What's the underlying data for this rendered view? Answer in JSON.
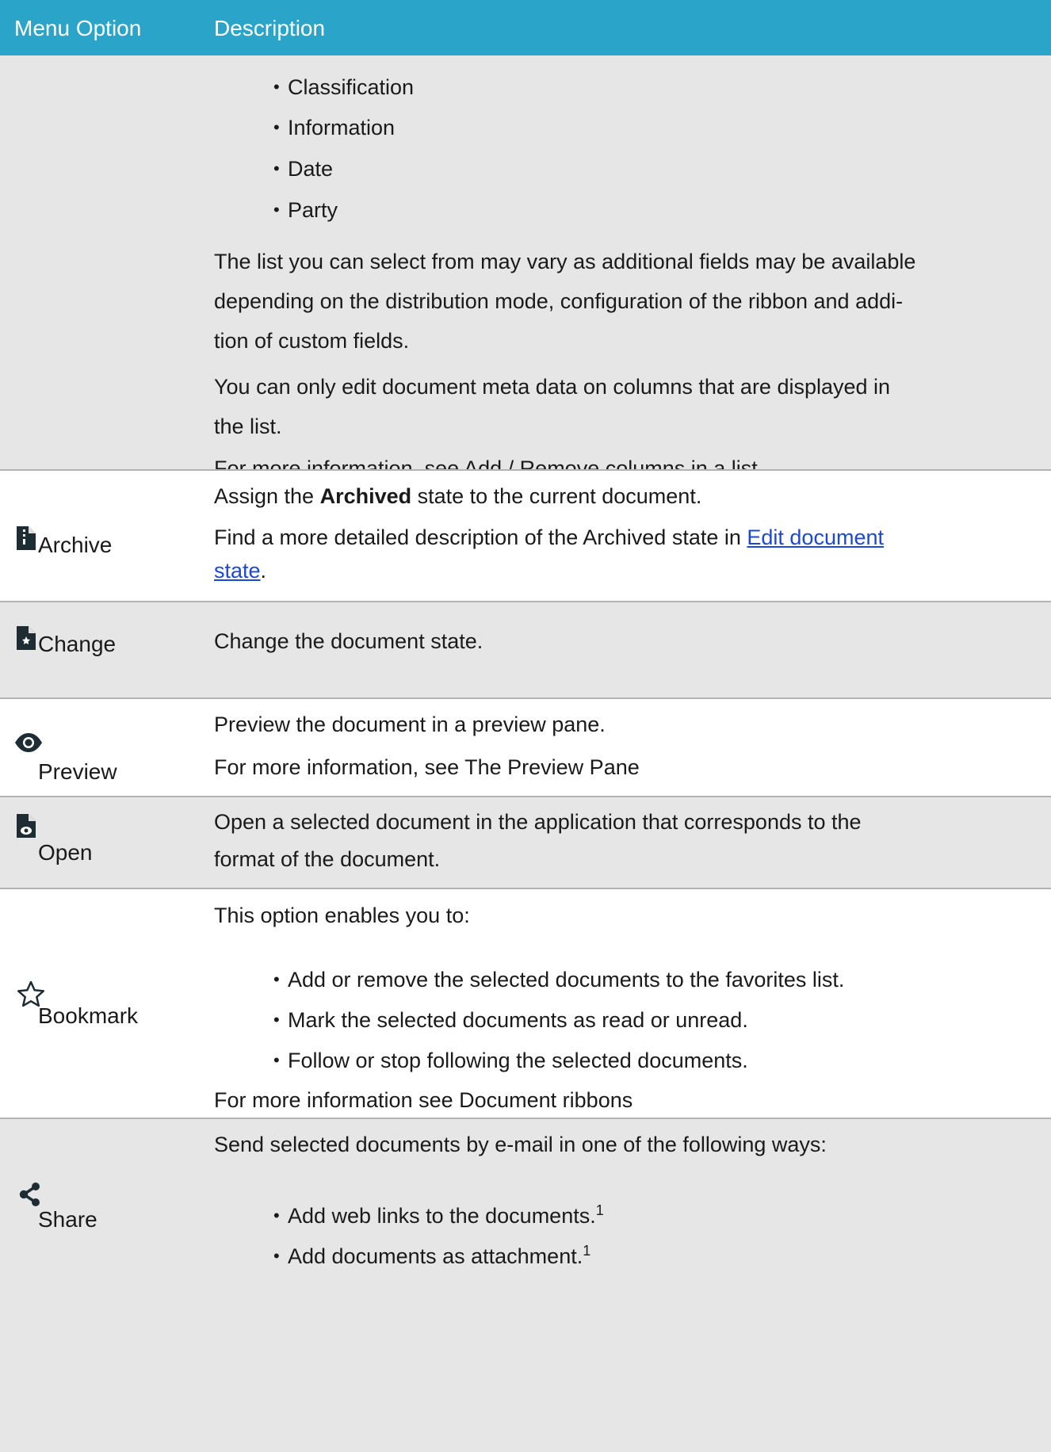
{
  "header": {
    "col1": "Menu Option",
    "col2": "Description"
  },
  "row_fields": {
    "bullets": [
      "Classification",
      "Information",
      "Date",
      "Party"
    ],
    "para1": "The list you can select from may vary as additional fields may be available depending on the distribution mode, configuration of the ribbon and addi-tion of custom fields.",
    "para1_lines": [
      "The list you can select from may vary as additional fields may be available",
      "depending on the distribution mode, configuration of the ribbon and addi-",
      "tion of custom fields."
    ],
    "para2_lines": [
      "You can only edit document meta data on columns that are displayed in",
      "the list."
    ],
    "para3": "For more information, see Add / Remove columns in a list."
  },
  "row_archive": {
    "label": "Archive",
    "icon": "archive-file-icon",
    "line1_pre": "Assign the ",
    "line1_bold": "Archived",
    "line1_post": " state to the current document.",
    "line2_pre": "Find a more detailed description of the Archived state in ",
    "link_part1": "Edit document",
    "link_part2": "state",
    "line3_post": "."
  },
  "row_change": {
    "label": "Change",
    "icon": "change-state-file-icon",
    "text": "Change the document state."
  },
  "row_preview": {
    "label": "Preview",
    "icon": "eye-icon",
    "line1": "Preview the document in a preview pane.",
    "line2": "For more information, see The Preview Pane"
  },
  "row_open": {
    "label": "Open",
    "icon": "open-file-icon",
    "line1": "Open a selected document in the application that corresponds to the",
    "line2": "format of the document."
  },
  "row_bookmark": {
    "label": "Bookmark",
    "icon": "star-icon",
    "intro": "This option enables you to:",
    "bullets": [
      "Add or remove the selected documents to the favorites list.",
      "Mark the selected documents as read or unread.",
      "Follow or stop following the selected documents."
    ],
    "footer": "For more information see Document ribbons"
  },
  "row_share": {
    "label": "Share",
    "icon": "share-icon",
    "intro": "Send selected documents by e-mail in one of the following ways:",
    "bullets": [
      "Add web links to the documents.",
      "Add documents as attachment."
    ],
    "footnote_mark": "1"
  },
  "colors": {
    "header": "#2ba4c9",
    "row_grey": "#e6e6e6",
    "link": "#1b48d9"
  }
}
